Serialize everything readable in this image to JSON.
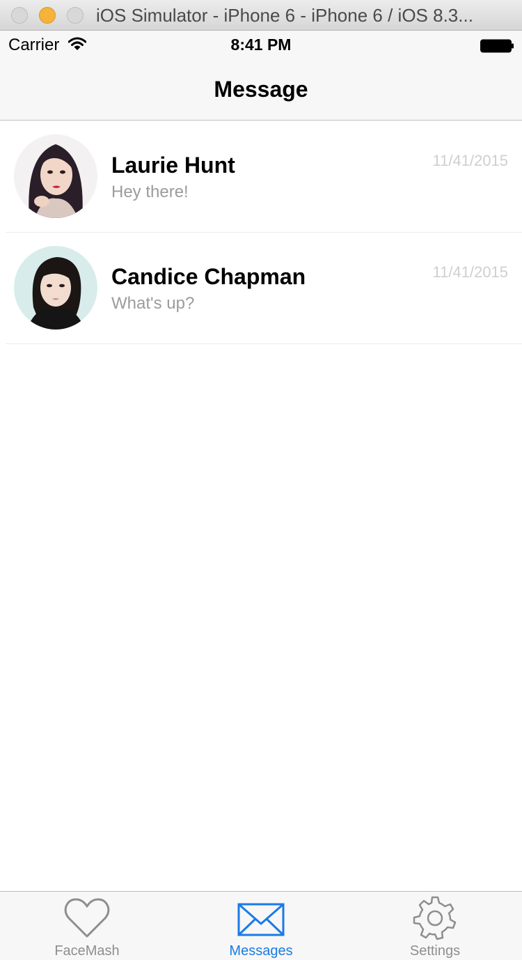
{
  "window": {
    "title": "iOS Simulator - iPhone 6 - iPhone 6 / iOS 8.3..."
  },
  "status_bar": {
    "carrier": "Carrier",
    "time": "8:41 PM",
    "icons": [
      "wifi-icon",
      "battery-icon"
    ]
  },
  "nav": {
    "title": "Message"
  },
  "messages": [
    {
      "name": "Laurie Hunt",
      "preview": "Hey there!",
      "date": "11/41/2015"
    },
    {
      "name": "Candice Chapman",
      "preview": "What's up?",
      "date": "11/41/2015"
    }
  ],
  "tabs": [
    {
      "label": "FaceMash",
      "icon": "heart-icon",
      "active": false
    },
    {
      "label": "Messages",
      "icon": "envelope-icon",
      "active": true
    },
    {
      "label": "Settings",
      "icon": "gear-icon",
      "active": false
    }
  ],
  "colors": {
    "accent": "#1a7be5",
    "inactive_tab": "#8e8e8e",
    "preview_text": "#9b9b9b",
    "date_text": "#cfcfcf"
  }
}
